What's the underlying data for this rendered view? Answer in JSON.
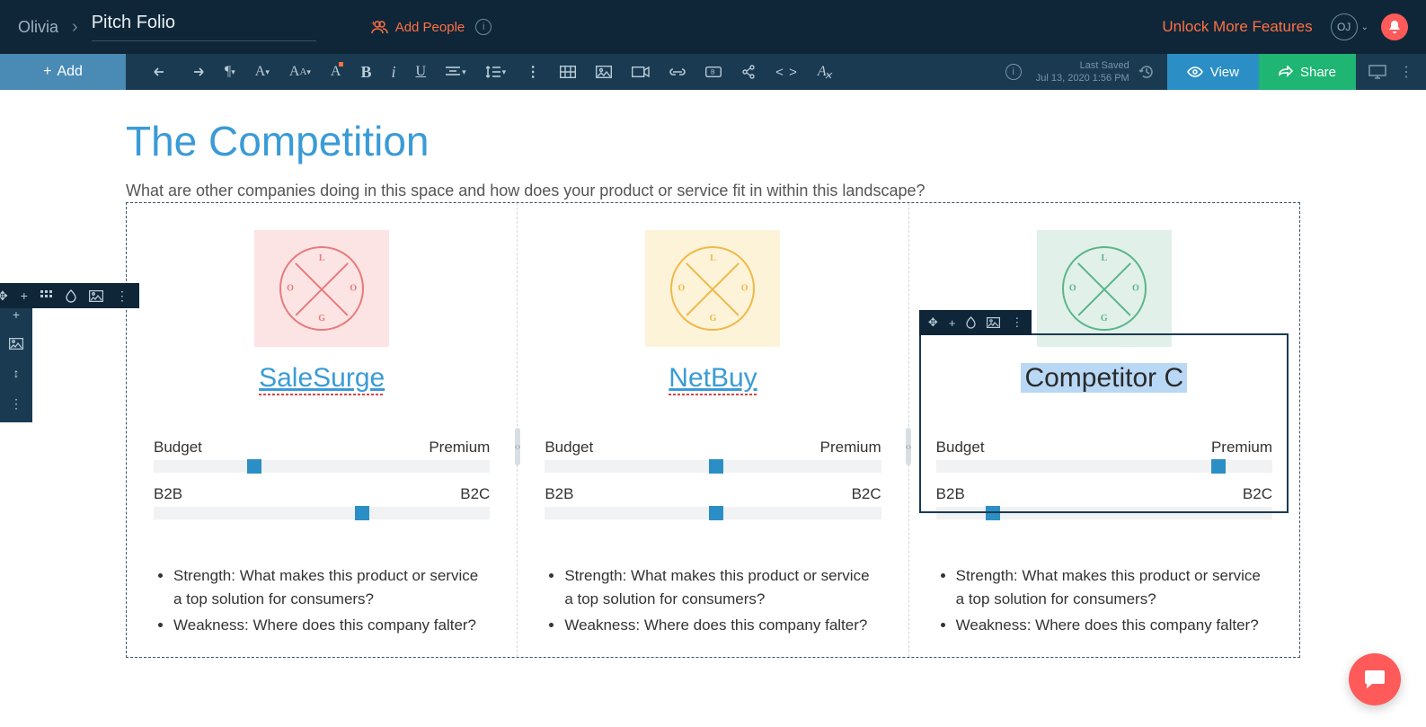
{
  "header": {
    "user": "Olivia",
    "doc_title": "Pitch Folio",
    "add_people": "Add People",
    "unlock": "Unlock More Features",
    "avatar_initials": "OJ"
  },
  "toolbar": {
    "add": "Add",
    "last_saved_label": "Last Saved",
    "last_saved_time": "Jul 13, 2020 1:56 PM",
    "view": "View",
    "share": "Share"
  },
  "doc": {
    "heading": "The Competition",
    "subtitle": "What are other companies doing in this space and how does your product or service fit in within this landscape?"
  },
  "slider_labels": {
    "left1": "Budget",
    "right1": "Premium",
    "left2": "B2B",
    "right2": "B2C"
  },
  "bullet_templates": {
    "strength": "Strength: What makes this product or service a top solution for consumers?",
    "weakness": "Weakness: Where does this company falter?"
  },
  "competitors": [
    {
      "name": "SaleSurge",
      "logo_color": "pink",
      "link": true,
      "spellflag": true,
      "slider1_pct": 30,
      "slider2_pct": 62
    },
    {
      "name": "NetBuy",
      "logo_color": "yellow",
      "link": true,
      "spellflag": true,
      "slider1_pct": 51,
      "slider2_pct": 51
    },
    {
      "name": "Competitor C",
      "logo_color": "green",
      "link": false,
      "selected": true,
      "slider1_pct": 84,
      "slider2_pct": 17
    }
  ],
  "logo_letters": {
    "top": "L",
    "right": "O",
    "bottom": "G",
    "left": "O"
  }
}
